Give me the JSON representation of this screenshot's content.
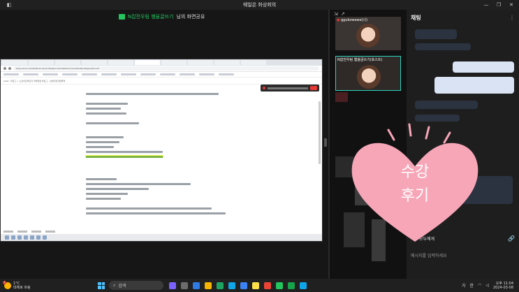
{
  "titlebar": {
    "title": "웨일온 화상회의"
  },
  "share_banner": {
    "presenter": "N잡전우림 햄율글쓰기",
    "suffix": "님의 화면공유"
  },
  "shared_screen": {
    "url": "blog.naver.com/PostList.naver?blogId=wrinkle&from=postList&categoryNo=25",
    "path": "www.. 블로그 > 스포이트챌린지 미래창업 블로그 · 상생다판자원플래"
  },
  "participants": {
    "header_icon": "participants-icon",
    "tiles": [
      {
        "label": "ggukowewe(나)"
      },
      {
        "label": "N잡전우림 햄율글쓰기(호스트)"
      }
    ]
  },
  "chat": {
    "title": "채팅",
    "recipient": "모두에게",
    "input_placeholder": "메시지를 입력하세요"
  },
  "sticker": {
    "line1": "수강",
    "line2": "후기"
  },
  "taskbar": {
    "weather_temp": "1°C",
    "weather_desc": "대체로 흐림",
    "search_placeholder": "검색",
    "ime_lang": "가",
    "ime_mode": "한",
    "time": "오후 11:04",
    "date": "2024-03-08"
  },
  "colors": {
    "accent": "#22c55e",
    "host_border": "#2dd4bf",
    "sticker": "#f7a6b8"
  }
}
